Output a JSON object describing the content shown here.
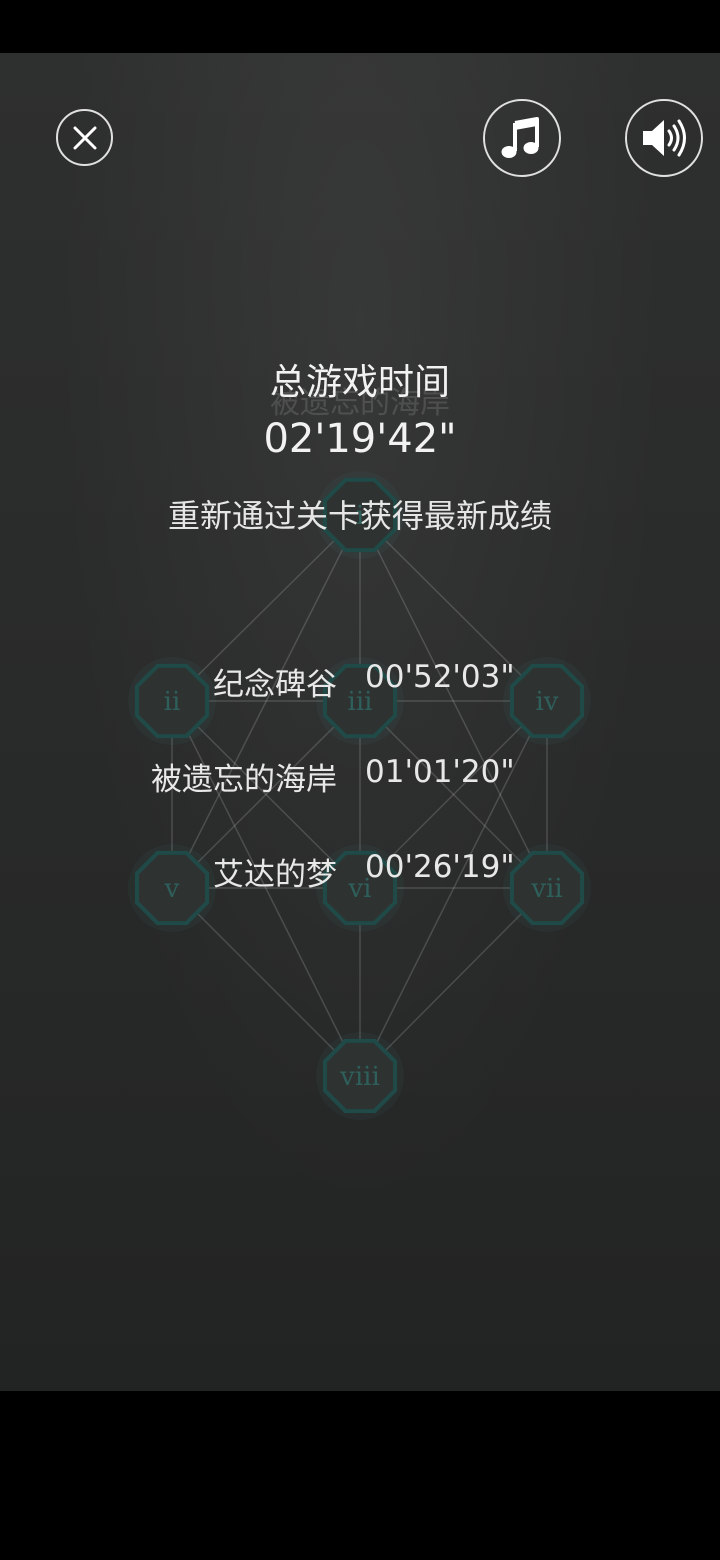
{
  "ghost_title": "被遗忘的海岸",
  "total_time_label": "总游戏时间",
  "total_time_value": "02'19'42\"",
  "hint": "重新通过关卡获得最新成绩",
  "records": [
    {
      "name": "纪念碑谷",
      "time": "00'52'03\""
    },
    {
      "name": "被遗忘的海岸",
      "time": "01'01'20\""
    },
    {
      "name": "艾达的梦",
      "time": "00'26'19\""
    }
  ],
  "chapters": [
    "i",
    "ii",
    "iii",
    "iv",
    "v",
    "vi",
    "vii",
    "viii"
  ],
  "icons": {
    "close": "close-icon",
    "music": "music-note-icon",
    "sound": "speaker-icon"
  },
  "colors": {
    "node_fill": "#2e3332",
    "node_stroke": "#1f4a47",
    "node_text": "#2e5f5b",
    "text": "#f2f2f2"
  }
}
